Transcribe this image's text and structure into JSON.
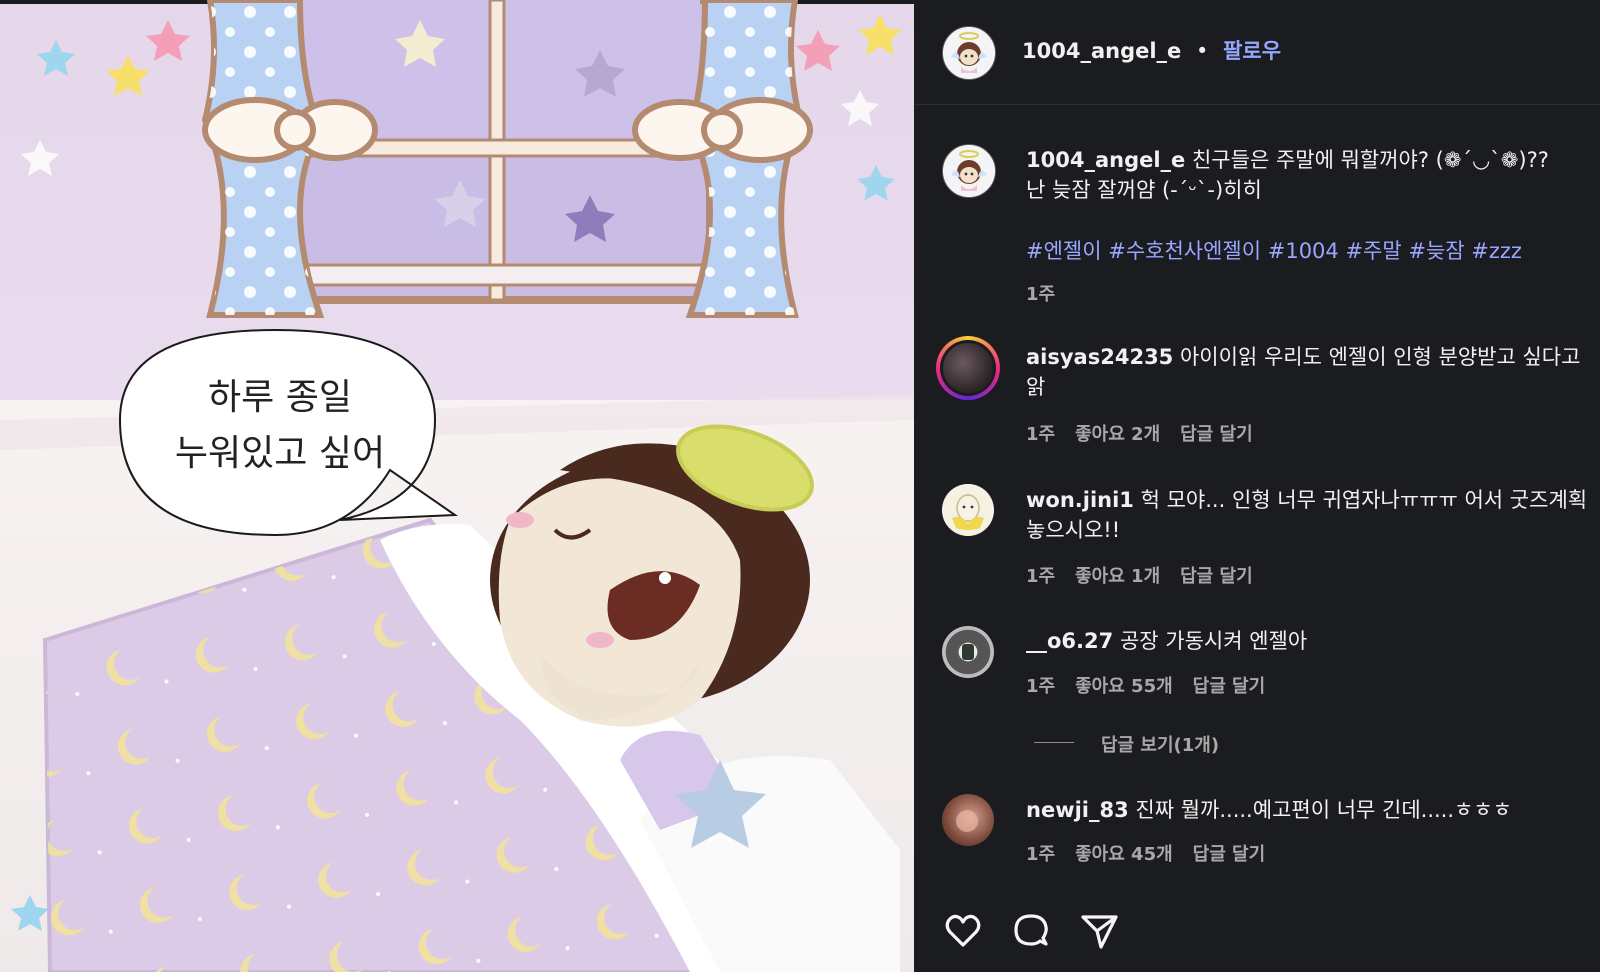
{
  "bubble": {
    "line1": "하루 종일",
    "line2": "누워있고 싶어"
  },
  "header": {
    "username": "1004_angel_e",
    "dot": "•",
    "follow": "팔로우"
  },
  "caption": {
    "username": "1004_angel_e",
    "line1": "친구들은 주말에 뭐할꺼야? (❁´◡`❁)??",
    "line2": "난 늦잠 잘꺼얌 (-´ᵕ`-)히히",
    "hashtags": "#엔젤이 #수호천사엔젤이 #1004 #주말 #늦잠 #zzz",
    "time": "1주"
  },
  "comments": [
    {
      "username": "aisyas24235",
      "text": "아이이읽 우리도 엔젤이 인형 분양받고 싶다고",
      "text2": "앍",
      "time": "1주",
      "likes": "좋아요 2개",
      "reply": "답글 달기"
    },
    {
      "username": "won.jini1",
      "text": "헉 모야... 인형 너무 귀엽자나ㅠㅠㅠ 어서 굿즈계획",
      "text2": "놓으시오!!",
      "time": "1주",
      "likes": "좋아요 1개",
      "reply": "답글 달기"
    },
    {
      "username": "__o6.27",
      "text": "공장 가동시켜 엔젤아",
      "text2": "",
      "time": "1주",
      "likes": "좋아요 55개",
      "reply": "답글 달기"
    },
    {
      "username": "newji_83",
      "text": "진짜 뭘까.....예고편이 너무 긴데.....ㅎㅎㅎ",
      "text2": "",
      "time": "1주",
      "likes": "좋아요 45개",
      "reply": "답글 달기"
    }
  ],
  "view_replies": "답글 보기(1개)",
  "actions": {
    "like_icon": "heart-icon",
    "comment_icon": "comment-icon",
    "share_icon": "share-icon"
  }
}
